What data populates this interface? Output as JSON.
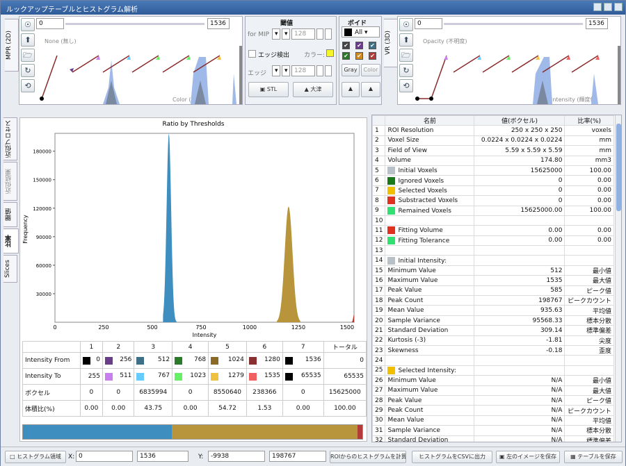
{
  "window": {
    "title": "ルックアップテーブルとヒストグラム解析"
  },
  "mpr": {
    "tab": "MPR (2D)",
    "min_value": "0",
    "max_value": "1536",
    "top_label": "None (無し)",
    "bottom_label": "Color (色)"
  },
  "vr": {
    "tab": "VR (3D)",
    "min_value": "0",
    "max_value": "1536",
    "top_label": "Opacity (不明度)",
    "bottom_label": "Intensity (輝度値)"
  },
  "threshold": {
    "header": "閾値",
    "for_mip": "for MIP",
    "mip_value": "128",
    "edge_check": "エッジ検出",
    "color_label": "カラー:",
    "edge_label": "エッジ",
    "edge_value": "128",
    "stl": "STL",
    "otsu": "大津"
  },
  "voids": {
    "header": "ボイド",
    "select": "All",
    "gray": "Gray",
    "color": "Color"
  },
  "left_tabs": [
    "近似プロセス",
    "近似結果",
    "閾値",
    "比率",
    "Slices"
  ],
  "chart_data": {
    "type": "area",
    "title": "Ratio by Thresholds",
    "xlabel": "Intensity",
    "ylabel": "Frequency",
    "xlim": [
      0,
      1536
    ],
    "ylim": [
      0,
      198767
    ],
    "x_ticks": [
      "0",
      "250",
      "500",
      "750",
      "1000",
      "1250",
      "1500"
    ],
    "y_ticks": [
      "30000",
      "60000",
      "90000",
      "120000",
      "150000",
      "180000"
    ],
    "series": [
      {
        "color": "#3e8fbf",
        "peak_x": 585,
        "peak_y": 198767,
        "x_start": 555,
        "x_end": 625
      },
      {
        "color": "#b8943a",
        "peak_x": 1200,
        "peak_y": 122000,
        "x_start": 1140,
        "x_end": 1260
      },
      {
        "color": "#b43a3a",
        "peak_x": 1536,
        "peak_y": 8000,
        "x_start": 1510,
        "x_end": 1536
      }
    ]
  },
  "table": {
    "headers": [
      "",
      "1",
      "2",
      "3",
      "4",
      "5",
      "6",
      "7",
      "トータル"
    ],
    "rows": [
      {
        "label": "Intensity From",
        "cells": [
          "0",
          "256",
          "512",
          "768",
          "1024",
          "1280",
          "1536",
          "0"
        ],
        "colors": [
          "#000000",
          "#6a3d8a",
          "#3d6f86",
          "#2a7a2a",
          "#8a6a24",
          "#8a3030",
          "#000000"
        ]
      },
      {
        "label": "Intensity To",
        "cells": [
          "255",
          "511",
          "767",
          "1023",
          "1279",
          "1535",
          "65535",
          "65535"
        ],
        "colors": [
          "",
          "#c77ff0",
          "#66ccff",
          "#66f066",
          "#f0c040",
          "#f06060",
          "#000000"
        ]
      },
      {
        "label": "ボクセル",
        "cells": [
          "0",
          "0",
          "6835994",
          "0",
          "8550640",
          "238366",
          "0",
          "15625000"
        ]
      },
      {
        "label": "体積比(%)",
        "cells": [
          "0.00",
          "0.00",
          "43.75",
          "0.00",
          "54.72",
          "1.53",
          "0.00",
          "100.00"
        ]
      }
    ]
  },
  "ratio_bar": [
    {
      "color": "#3e8fbf",
      "pct": 43.75
    },
    {
      "color": "#b8943a",
      "pct": 54.72
    },
    {
      "color": "#b43a3a",
      "pct": 1.53
    }
  ],
  "roi": {
    "headers": [
      "",
      "名前",
      "値(ボクセル)",
      "比率(%)"
    ],
    "rows": [
      [
        "1",
        "",
        "ROI Resolution",
        "250 x 250 x 250",
        "voxels"
      ],
      [
        "2",
        "",
        "Voxel Size",
        "0.0224 x 0.0224 x 0.0224",
        "mm"
      ],
      [
        "3",
        "",
        "Field of View",
        "5.59 x 5.59 x 5.59",
        "mm"
      ],
      [
        "4",
        "",
        "Volume",
        "174.80",
        "mm3"
      ],
      [
        "5",
        "#b8c0c8",
        "Initial Voxels",
        "15625000",
        "100.00"
      ],
      [
        "6",
        "#1a7a1a",
        "Ignored Voxels",
        "0",
        "0.00"
      ],
      [
        "7",
        "#f0c000",
        "Selected Voxels",
        "0",
        "0.00"
      ],
      [
        "8",
        "#e03020",
        "Substracted Voxels",
        "0",
        "0.00"
      ],
      [
        "9",
        "#30e070",
        "Remained Voxels",
        "15625000.00",
        "100.00"
      ],
      [
        "10",
        "",
        "",
        "",
        ""
      ],
      [
        "11",
        "#e03020",
        "Fitting Volume",
        "0.00",
        "0.00"
      ],
      [
        "12",
        "#30e070",
        "Fitting Tolerance",
        "0.00",
        "0.00"
      ],
      [
        "13",
        "",
        "",
        "",
        ""
      ],
      [
        "14",
        "#b8c0c8",
        "Initial Intensity:",
        "",
        ""
      ],
      [
        "15",
        "",
        "Minimum Value",
        "512",
        "最小値"
      ],
      [
        "16",
        "",
        "Maximum Value",
        "1535",
        "最大値"
      ],
      [
        "17",
        "",
        "Peak Value",
        "585",
        "ピーク値"
      ],
      [
        "18",
        "",
        "Peak Count",
        "198767",
        "ピークカウント"
      ],
      [
        "19",
        "",
        "Mean Value",
        "935.63",
        "平均値"
      ],
      [
        "20",
        "",
        "Sample Variance",
        "95568.33",
        "標本分散"
      ],
      [
        "21",
        "",
        "Standard Deviation",
        "309.14",
        "標準偏差"
      ],
      [
        "22",
        "",
        "Kurtosis (-3)",
        "-1.81",
        "尖度"
      ],
      [
        "23",
        "",
        "Skewness",
        "-0.18",
        "歪度"
      ],
      [
        "24",
        "",
        "",
        "",
        ""
      ],
      [
        "25",
        "#f0c000",
        "Selected Intensity:",
        "",
        ""
      ],
      [
        "26",
        "",
        "Minimum Value",
        "N/A",
        "最小値"
      ],
      [
        "27",
        "",
        "Maximum Value",
        "N/A",
        "最大値"
      ],
      [
        "28",
        "",
        "Peak Value",
        "N/A",
        "ピーク値"
      ],
      [
        "29",
        "",
        "Peak Count",
        "N/A",
        "ピークカウント"
      ],
      [
        "30",
        "",
        "Mean Value",
        "N/A",
        "平均値"
      ],
      [
        "31",
        "",
        "Sample Variance",
        "N/A",
        "標本分散"
      ],
      [
        "32",
        "",
        "Standard Deviation",
        "N/A",
        "標準偏差"
      ]
    ]
  },
  "bottom": {
    "hist_area": "ヒストグラム領域",
    "x_label": "X:",
    "x_from": "0",
    "x_to": "1536",
    "y_label": "Y:",
    "y_from": "-9938",
    "y_to": "198767",
    "roi_calc": "ROIからのヒストグラムを計算",
    "csv": "ヒストグラムをCSVに出力",
    "save_img": "左のイメージを保存",
    "save_tbl": "テーブルを保存"
  }
}
